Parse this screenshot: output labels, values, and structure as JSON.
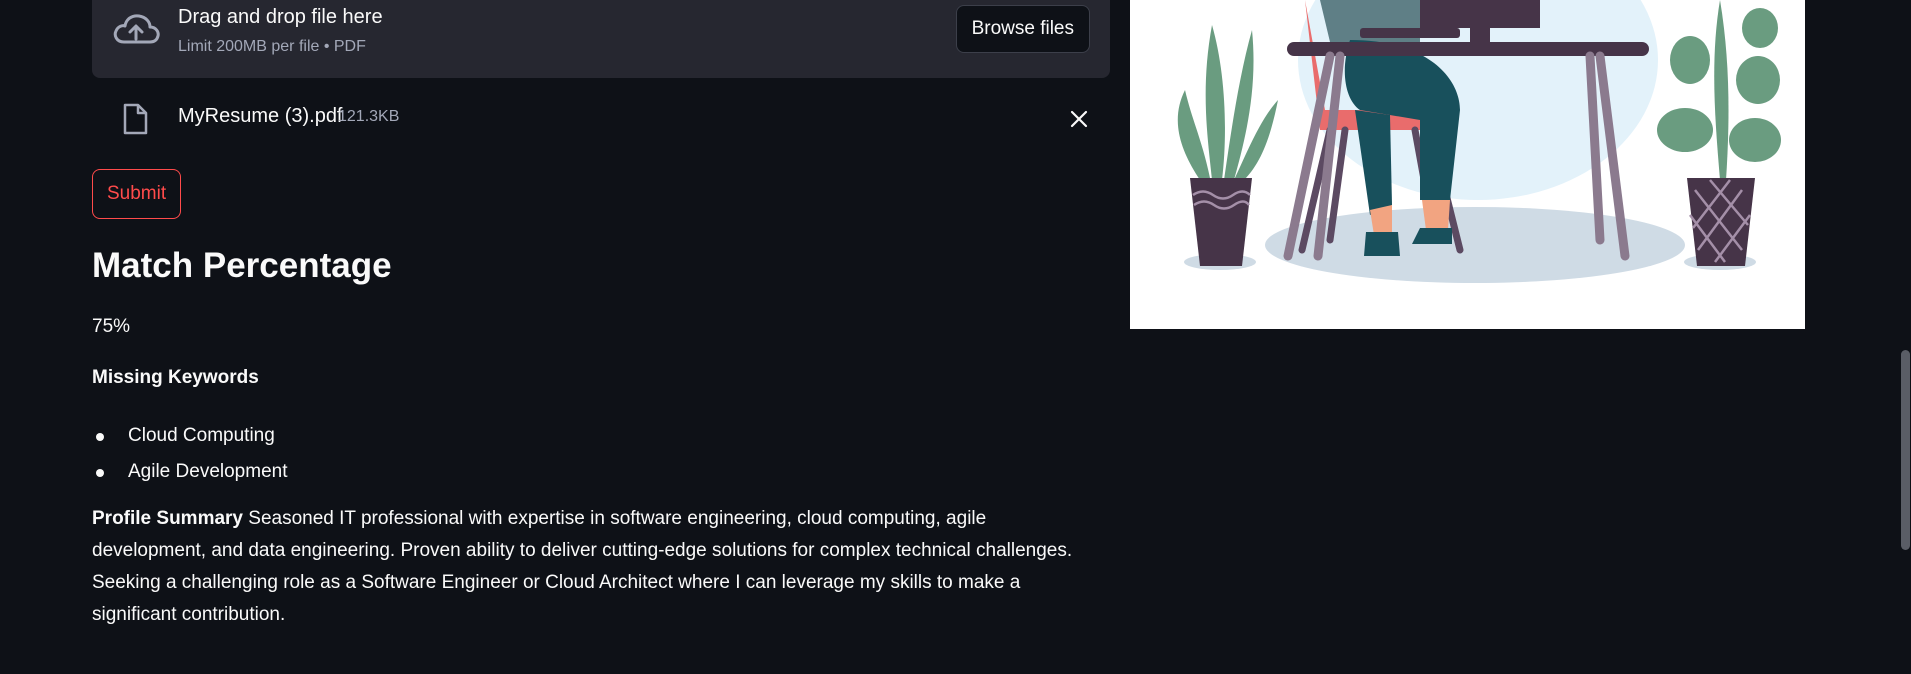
{
  "uploader": {
    "drop_title": "Drag and drop file here",
    "drop_subtitle": "Limit 200MB per file • PDF",
    "browse_label": "Browse files",
    "icon": "cloud-upload-icon"
  },
  "uploaded_file": {
    "name": "MyResume (3).pdf",
    "size": "121.3KB",
    "icon": "file-icon"
  },
  "submit_label": "Submit",
  "result": {
    "heading": "Match Percentage",
    "match_value": "75%",
    "missing_title": "Missing Keywords",
    "missing_keywords": [
      "Cloud Computing",
      "Agile Development"
    ],
    "summary_label": "Profile Summary",
    "summary_text": "Seasoned IT professional with expertise in software engineering, cloud computing, agile development, and data engineering. Proven ability to deliver cutting-edge solutions for complex technical challenges. Seeking a challenging role as a Software Engineer or Cloud Architect where I can leverage my skills to make a significant contribution."
  },
  "colors": {
    "background": "#0e1117",
    "panel": "#262730",
    "accent": "#ff4b4b",
    "muted_text": "#a3a8b8"
  }
}
